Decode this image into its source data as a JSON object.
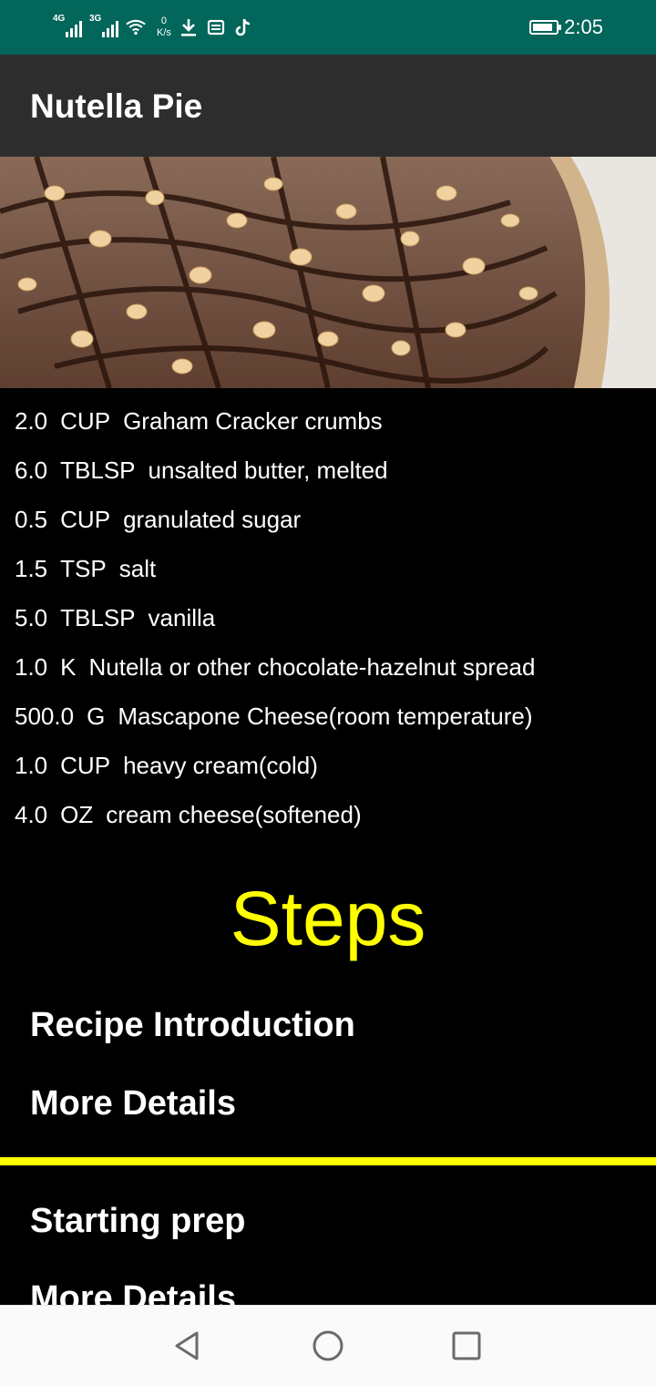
{
  "status_bar": {
    "signal1_tag": "4G",
    "signal2_tag": "3G",
    "net_speed_value": "0",
    "net_speed_unit": "K/s",
    "time": "2:05",
    "battery_level": 0.85,
    "icons": [
      "signal-4g-icon",
      "signal-3g-icon",
      "wifi-icon",
      "download-icon",
      "sim-card-icon",
      "tiktok-icon",
      "battery-icon"
    ]
  },
  "app_bar": {
    "title": "Nutella Pie"
  },
  "ingredients": [
    {
      "qty": "2.0",
      "unit": "CUP",
      "name": "Graham Cracker crumbs"
    },
    {
      "qty": "6.0",
      "unit": "TBLSP",
      "name": "unsalted butter, melted"
    },
    {
      "qty": "0.5",
      "unit": "CUP",
      "name": "granulated sugar"
    },
    {
      "qty": "1.5",
      "unit": "TSP",
      "name": "salt"
    },
    {
      "qty": "5.0",
      "unit": "TBLSP",
      "name": "vanilla"
    },
    {
      "qty": "1.0",
      "unit": "K",
      "name": "Nutella or other chocolate-hazelnut spread"
    },
    {
      "qty": "500.0",
      "unit": "G",
      "name": "Mascapone Cheese(room temperature)"
    },
    {
      "qty": "1.0",
      "unit": "CUP",
      "name": "heavy cream(cold)"
    },
    {
      "qty": "4.0",
      "unit": "OZ",
      "name": "cream cheese(softened)"
    }
  ],
  "steps": {
    "heading": "Steps",
    "items": [
      {
        "title": "Recipe Introduction",
        "details": "More Details"
      },
      {
        "title": "Starting prep",
        "details": "More Details"
      }
    ]
  },
  "colors": {
    "status_bar": "#03665a",
    "app_bar": "#2d2d2d",
    "background": "#000000",
    "accent_yellow": "#ffff00",
    "text": "#ffffff"
  },
  "nav_bar": {
    "buttons": [
      "back-icon",
      "home-icon",
      "recents-icon"
    ]
  }
}
